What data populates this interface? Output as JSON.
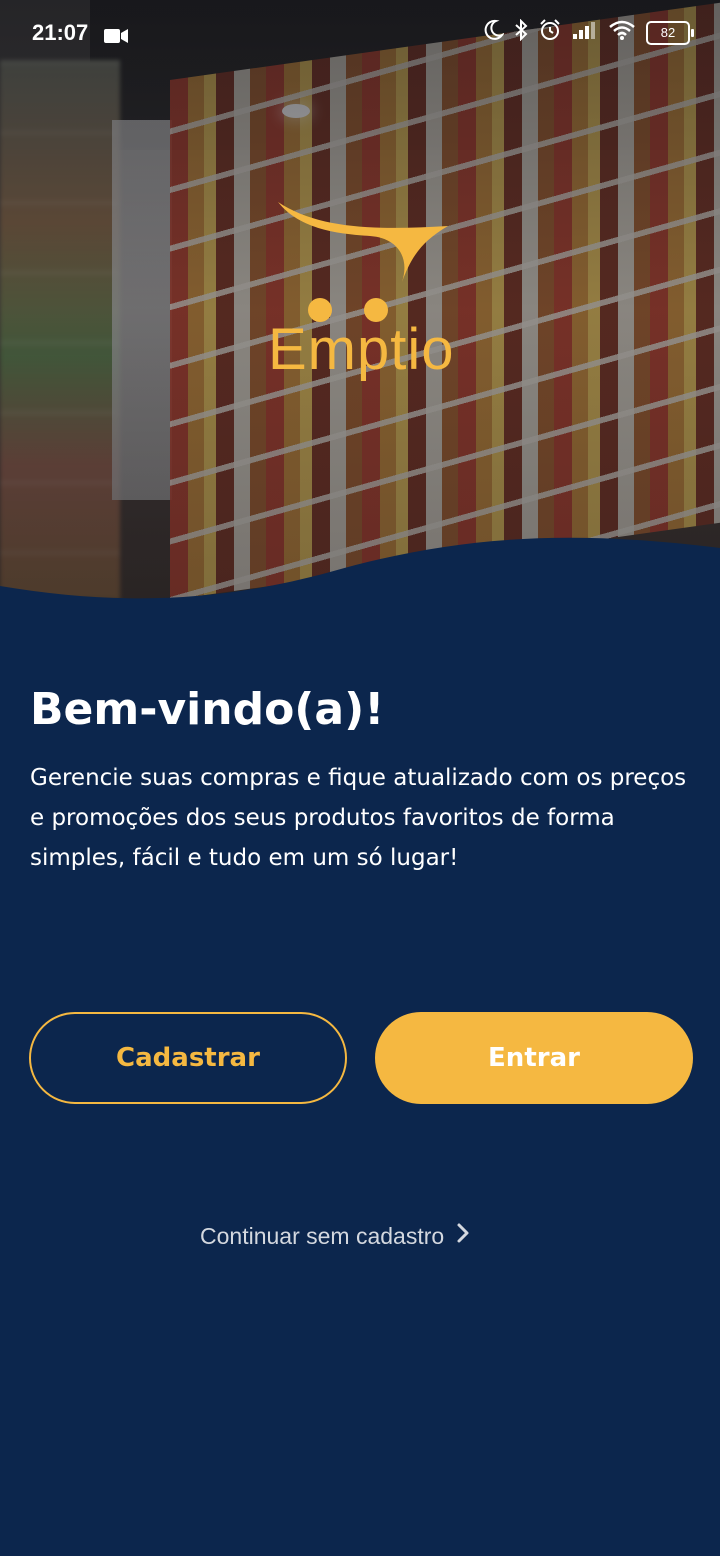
{
  "status_bar": {
    "time": "21:07",
    "battery": "82"
  },
  "brand": {
    "name": "Emptio",
    "color": "#f5b841"
  },
  "welcome": {
    "title": "Bem-vindo(a)!",
    "description": "Gerencie suas compras e fique atualizado com os preços e promoções dos seus produtos favoritos de forma simples, fácil e tudo em um só lugar!"
  },
  "actions": {
    "register_label": "Cadastrar",
    "login_label": "Entrar",
    "continue_label": "Continuar sem cadastro"
  },
  "colors": {
    "background": "#0c264d",
    "accent": "#f5b841",
    "text": "#ffffff"
  }
}
